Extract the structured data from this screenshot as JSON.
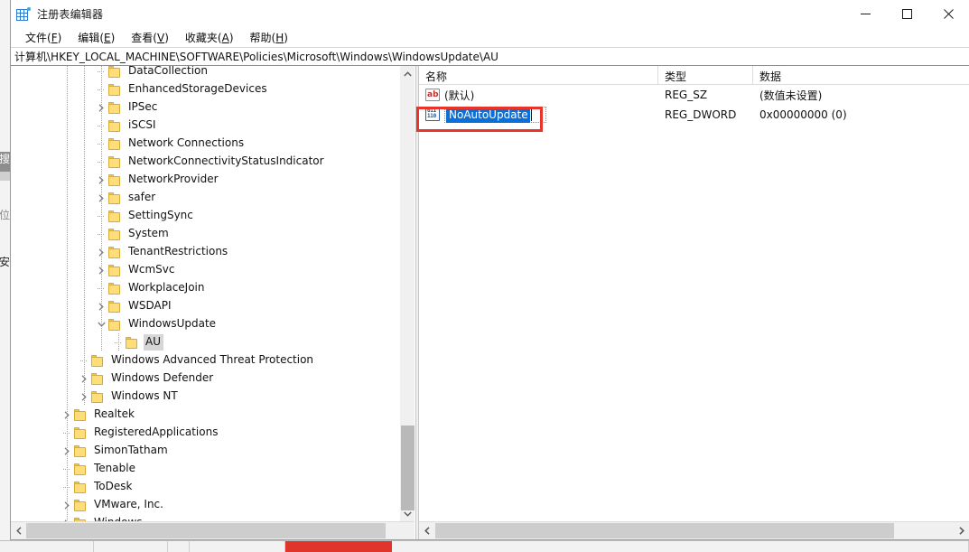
{
  "window": {
    "title": "注册表编辑器",
    "icon": "registry-editor-icon",
    "controls": {
      "minimize": "最小化",
      "maximize": "最大化",
      "close": "关闭"
    }
  },
  "menubar": {
    "items": [
      {
        "label": "文件",
        "accel": "F"
      },
      {
        "label": "编辑",
        "accel": "E"
      },
      {
        "label": "查看",
        "accel": "V"
      },
      {
        "label": "收藏夹",
        "accel": "A"
      },
      {
        "label": "帮助",
        "accel": "H"
      }
    ]
  },
  "address": {
    "path": "计算机\\HKEY_LOCAL_MACHINE\\SOFTWARE\\Policies\\Microsoft\\Windows\\WindowsUpdate\\AU"
  },
  "tree": {
    "nodes": [
      {
        "label": "DataCollection",
        "depth": 3,
        "expander": "none",
        "selected": false
      },
      {
        "label": "EnhancedStorageDevices",
        "depth": 3,
        "expander": "none",
        "selected": false
      },
      {
        "label": "IPSec",
        "depth": 3,
        "expander": "collapsed",
        "selected": false
      },
      {
        "label": "iSCSI",
        "depth": 3,
        "expander": "none",
        "selected": false
      },
      {
        "label": "Network Connections",
        "depth": 3,
        "expander": "none",
        "selected": false
      },
      {
        "label": "NetworkConnectivityStatusIndicator",
        "depth": 3,
        "expander": "none",
        "selected": false
      },
      {
        "label": "NetworkProvider",
        "depth": 3,
        "expander": "collapsed",
        "selected": false
      },
      {
        "label": "safer",
        "depth": 3,
        "expander": "collapsed",
        "selected": false
      },
      {
        "label": "SettingSync",
        "depth": 3,
        "expander": "none",
        "selected": false
      },
      {
        "label": "System",
        "depth": 3,
        "expander": "none",
        "selected": false
      },
      {
        "label": "TenantRestrictions",
        "depth": 3,
        "expander": "collapsed",
        "selected": false
      },
      {
        "label": "WcmSvc",
        "depth": 3,
        "expander": "collapsed",
        "selected": false
      },
      {
        "label": "WorkplaceJoin",
        "depth": 3,
        "expander": "none",
        "selected": false
      },
      {
        "label": "WSDAPI",
        "depth": 3,
        "expander": "collapsed",
        "selected": false
      },
      {
        "label": "WindowsUpdate",
        "depth": 3,
        "expander": "expanded",
        "selected": false
      },
      {
        "label": "AU",
        "depth": 4,
        "expander": "none",
        "selected": true
      },
      {
        "label": "Windows Advanced Threat Protection",
        "depth": 2,
        "expander": "none",
        "selected": false
      },
      {
        "label": "Windows Defender",
        "depth": 2,
        "expander": "collapsed",
        "selected": false
      },
      {
        "label": "Windows NT",
        "depth": 2,
        "expander": "collapsed",
        "selected": false
      },
      {
        "label": "Realtek",
        "depth": 1,
        "expander": "collapsed",
        "selected": false
      },
      {
        "label": "RegisteredApplications",
        "depth": 1,
        "expander": "none",
        "selected": false
      },
      {
        "label": "SimonTatham",
        "depth": 1,
        "expander": "collapsed",
        "selected": false
      },
      {
        "label": "Tenable",
        "depth": 1,
        "expander": "none",
        "selected": false
      },
      {
        "label": "ToDesk",
        "depth": 1,
        "expander": "none",
        "selected": false
      },
      {
        "label": "VMware, Inc.",
        "depth": 1,
        "expander": "collapsed",
        "selected": false
      },
      {
        "label": "Windows",
        "depth": 1,
        "expander": "collapsed",
        "selected": false
      }
    ]
  },
  "list": {
    "columns": [
      {
        "key": "name",
        "label": "名称"
      },
      {
        "key": "type",
        "label": "类型"
      },
      {
        "key": "data",
        "label": "数据"
      }
    ],
    "rows": [
      {
        "icon": "reg-sz-icon",
        "name": "(默认)",
        "type": "REG_SZ",
        "data": "(数值未设置)",
        "editing": false
      },
      {
        "icon": "reg-dword-icon",
        "name": "NoAutoUpdate",
        "type": "REG_DWORD",
        "data": "0x00000000 (0)",
        "editing": true
      }
    ]
  },
  "annotation": {
    "color": "#e8342b",
    "target": "NoAutoUpdate"
  },
  "colors": {
    "selection_blue": "#0b6fd8",
    "folder_yellow": "#ffde7a",
    "tree_selected_gray": "#d6d6d6",
    "taskbar_active_red": "#e0352b"
  },
  "taskbar": {
    "active_item": "active-task"
  }
}
